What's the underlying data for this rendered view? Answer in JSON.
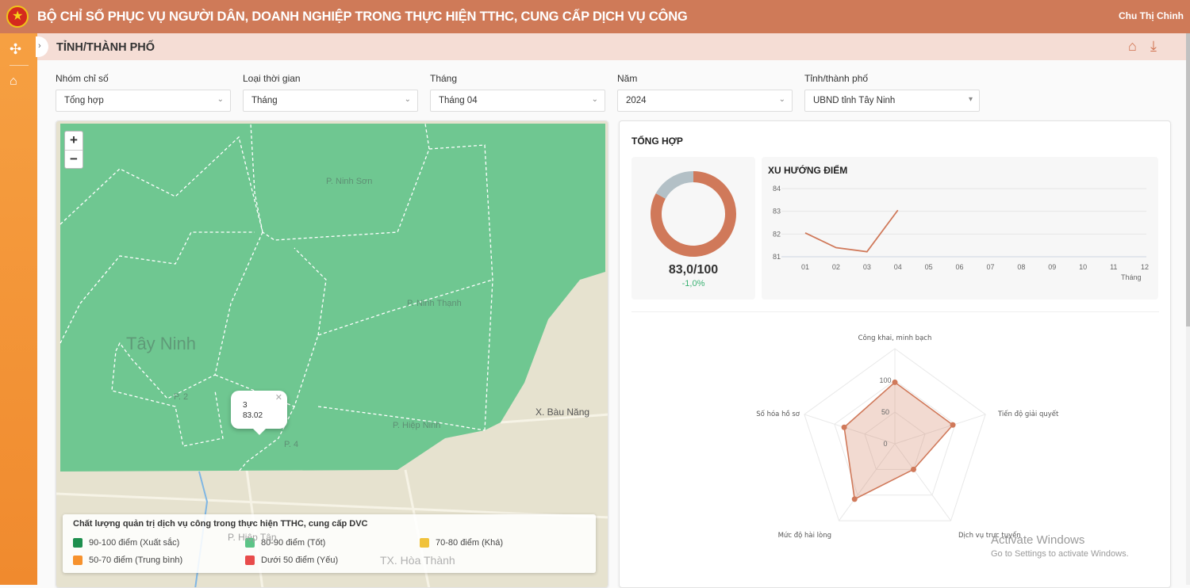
{
  "header": {
    "title": "BỘ CHỈ SỐ PHỤC VỤ NGƯỜI DÂN, DOANH NGHIỆP TRONG THỰC HIỆN TTHC, CUNG CẤP DỊCH VỤ CÔNG",
    "user": "Chu Thị Chinh"
  },
  "sidebar": {
    "items": [
      {
        "icon": "collapse-arrows-icon"
      },
      {
        "icon": "home-icon"
      }
    ]
  },
  "page": {
    "title": "TỈNH/THÀNH PHỐ",
    "toolbar_icons": [
      "home-icon",
      "download-icon"
    ]
  },
  "filters": [
    {
      "label": "Nhóm chỉ số",
      "value": "Tổng hợp"
    },
    {
      "label": "Loại thời gian",
      "value": "Tháng"
    },
    {
      "label": "Tháng",
      "value": "Tháng 04"
    },
    {
      "label": "Năm",
      "value": "2024"
    },
    {
      "label": "Tỉnh/thành phố",
      "value": "UBND tỉnh Tây Ninh"
    }
  ],
  "map": {
    "labels": [
      "P. Ninh Sơn",
      "P. Ninh Thạnh",
      "Tây Ninh",
      "P. 2",
      "P. 4",
      "P. Hiệp Ninh",
      "X. Bàu Năng",
      "P. Hiệp Tân",
      "TX. Hòa Thành"
    ],
    "popup": {
      "name": "3",
      "value": "83.02"
    },
    "legend": {
      "title": "Chất lượng quản trị dịch vụ công trong thực hiện TTHC, cung cấp DVC",
      "items": [
        {
          "label": "90-100 điểm (Xuất sắc)",
          "color": "#1e8f4e"
        },
        {
          "label": "80-90 điểm (Tốt)",
          "color": "#5cc487"
        },
        {
          "label": "70-80 điểm (Khá)",
          "color": "#f0c23b"
        },
        {
          "label": "50-70 điểm (Trung bình)",
          "color": "#f7922d"
        },
        {
          "label": "Dưới 50 điểm (Yếu)",
          "color": "#e84c4c"
        }
      ]
    }
  },
  "summary": {
    "title": "TỔNG HỢP",
    "score": "83,0/100",
    "change": "-1,0%",
    "change_color": "#3bb273",
    "accent": "#d0714e"
  },
  "chart_data": [
    {
      "type": "pie",
      "variant": "donut",
      "values": [
        83,
        17
      ],
      "colors": [
        "#d0795a",
        "#b3c0c6"
      ]
    },
    {
      "type": "line",
      "title": "XU HƯỚNG ĐIỂM",
      "xlabel": "Tháng",
      "categories": [
        "01",
        "02",
        "03",
        "04",
        "05",
        "06",
        "07",
        "08",
        "09",
        "10",
        "11",
        "12"
      ],
      "values": [
        82.05,
        81.4,
        81.22,
        83.05,
        null,
        null,
        null,
        null,
        null,
        null,
        null,
        null
      ],
      "ylim": [
        81,
        84
      ],
      "yticks": [
        81,
        82,
        83,
        84
      ],
      "grid": true,
      "color": "#d0795a"
    },
    {
      "type": "radar",
      "axes": [
        "Công khai, minh bạch",
        "Tiến độ giải quyết",
        "Dịch vụ trực tuyến",
        "Mức độ hài lòng",
        "Số hóa hồ sơ"
      ],
      "values": [
        97,
        96,
        50,
        108,
        84
      ],
      "rlim": [
        0,
        150
      ],
      "rticks": [
        "0",
        "50",
        "100"
      ],
      "color": "#d0795a"
    }
  ],
  "watermark": {
    "line1": "Activate Windows",
    "line2": "Go to Settings to activate Windows."
  }
}
